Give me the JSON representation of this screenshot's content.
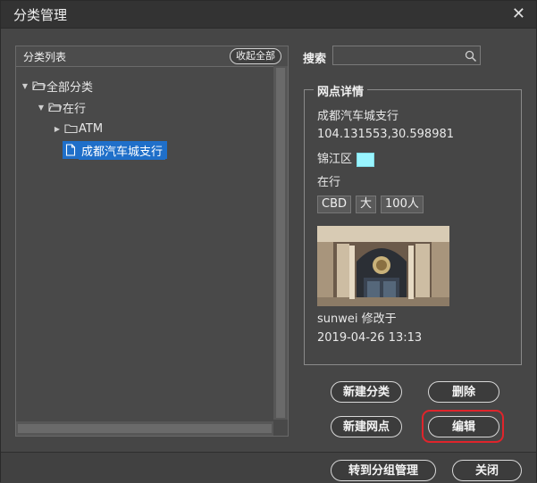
{
  "dialog": {
    "title": "分类管理",
    "close_glyph": "✕"
  },
  "left_panel": {
    "title": "分类列表",
    "collapse_all_label": "收起全部",
    "tree": [
      {
        "label": "全部分类",
        "level": 0,
        "expanded": true,
        "type": "folder"
      },
      {
        "label": "在行",
        "level": 1,
        "expanded": true,
        "type": "folder"
      },
      {
        "label": "ATM",
        "level": 2,
        "expanded": false,
        "type": "folder"
      },
      {
        "label": "成都汽车城支行",
        "level": 2,
        "expanded": false,
        "type": "file",
        "selected": true
      }
    ]
  },
  "search": {
    "label": "搜索",
    "value": "",
    "placeholder": ""
  },
  "details": {
    "legend": "网点详情",
    "name": "成都汽车城支行",
    "coordinates": "104.131553,30.598981",
    "district": "锦江区",
    "district_color": "#99f5ff",
    "category": "在行",
    "tags": [
      "CBD",
      "大",
      "100人"
    ],
    "modified_by": "sunwei 修改于",
    "modified_time": "2019-04-26 13:13"
  },
  "actions": {
    "new_category": "新建分类",
    "delete": "删除",
    "new_outlet": "新建网点",
    "edit": "编辑"
  },
  "footer": {
    "to_group_management": "转到分组管理",
    "close": "关闭"
  },
  "colors": {
    "selection": "#1f6fc9",
    "highlight_ring": "#e0242b"
  }
}
